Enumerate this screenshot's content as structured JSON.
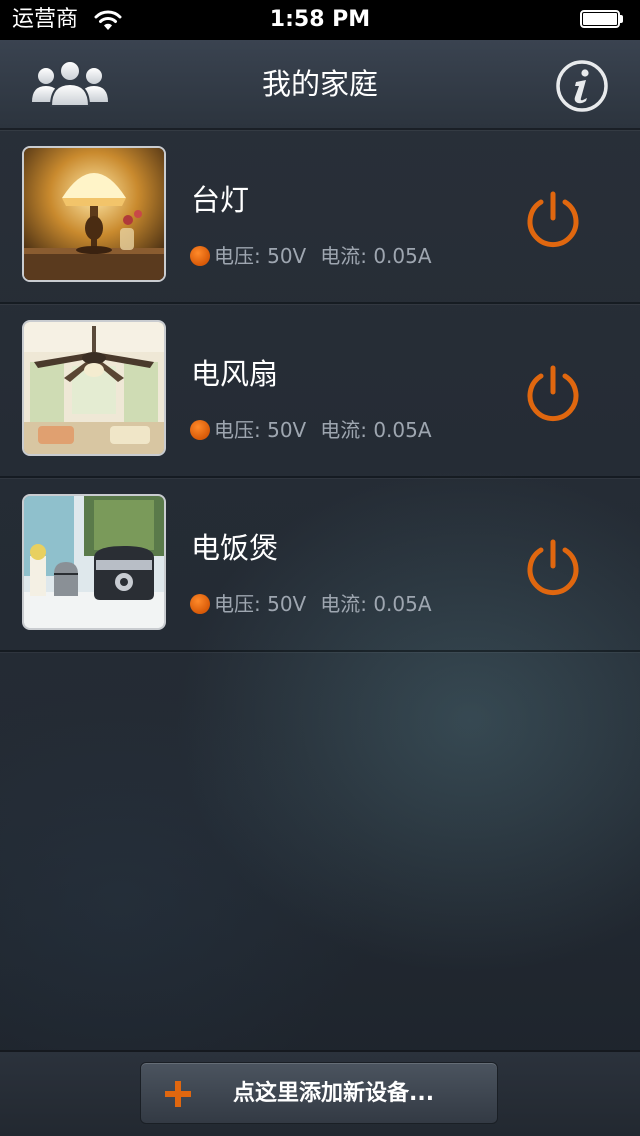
{
  "status_bar": {
    "carrier": "运营商",
    "time": "1:58 PM",
    "battery_level": 1.0,
    "icons": [
      "wifi-icon",
      "battery-icon"
    ]
  },
  "nav": {
    "title": "我的家庭",
    "left_icon": "users-icon",
    "right_icon": "info-icon"
  },
  "devices": [
    {
      "name": "台灯",
      "voltage": "电压: 50V",
      "current": "电流: 0.05A",
      "image": "table-lamp",
      "power_icon": "power-icon"
    },
    {
      "name": "电风扇",
      "voltage": "电压: 50V",
      "current": "电流: 0.05A",
      "image": "ceiling-fan",
      "power_icon": "power-icon"
    },
    {
      "name": "电饭煲",
      "voltage": "电压: 50V",
      "current": "电流: 0.05A",
      "image": "rice-cooker",
      "power_icon": "power-icon"
    }
  ],
  "footer": {
    "add_label": "点这里添加新设备...",
    "add_icon": "plus-icon"
  },
  "colors": {
    "accent": "#e0670f",
    "status_dot": "#e0670f",
    "text_primary": "#ffffff",
    "text_secondary": "#9ea6b0"
  }
}
